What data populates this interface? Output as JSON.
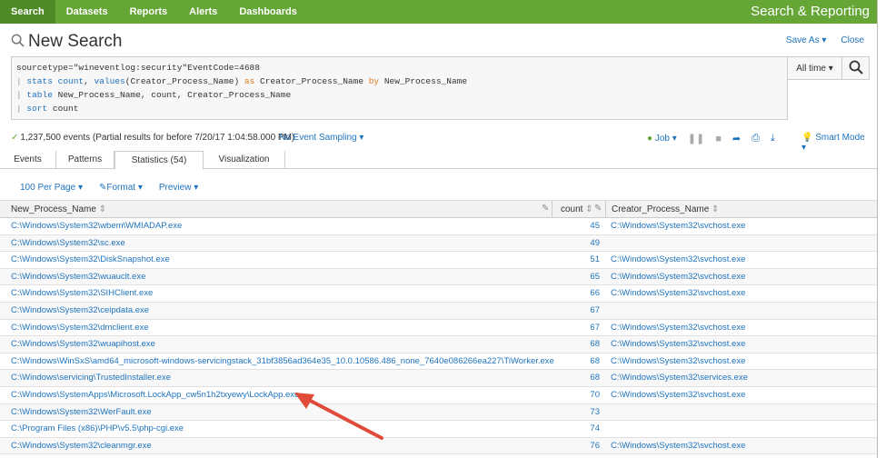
{
  "nav": {
    "items": [
      "Search",
      "Datasets",
      "Reports",
      "Alerts",
      "Dashboards"
    ],
    "app_title": "Search & Reporting"
  },
  "header": {
    "title": "New Search",
    "save_as": "Save As",
    "close": "Close"
  },
  "search": {
    "query_lines": [
      [
        {
          "t": "plain",
          "v": "sourcetype=\"wineventlog:security\"EventCode=4688"
        }
      ],
      [
        {
          "t": "pipe",
          "v": "| "
        },
        {
          "t": "cmd",
          "v": "stats"
        },
        {
          "t": "plain",
          "v": " "
        },
        {
          "t": "cmd",
          "v": "count"
        },
        {
          "t": "plain",
          "v": ", "
        },
        {
          "t": "cmd",
          "v": "values"
        },
        {
          "t": "plain",
          "v": "(Creator_Process_Name) "
        },
        {
          "t": "kw",
          "v": "as"
        },
        {
          "t": "plain",
          "v": " Creator_Process_Name "
        },
        {
          "t": "kw",
          "v": "by"
        },
        {
          "t": "plain",
          "v": " New_Process_Name"
        }
      ],
      [
        {
          "t": "pipe",
          "v": "| "
        },
        {
          "t": "cmd",
          "v": "table"
        },
        {
          "t": "plain",
          "v": " New_Process_Name, count, Creator_Process_Name"
        }
      ],
      [
        {
          "t": "pipe",
          "v": "| "
        },
        {
          "t": "cmd",
          "v": "sort"
        },
        {
          "t": "plain",
          "v": " count"
        }
      ]
    ],
    "time_range": "All time"
  },
  "status": {
    "events": "1,237,500 events (Partial results for before 7/20/17 1:04:58.000 PM)",
    "sampling": "No Event Sampling",
    "job": "Job",
    "mode": "Smart Mode"
  },
  "tabs": [
    "Events",
    "Patterns",
    "Statistics (54)",
    "Visualization"
  ],
  "table_controls": {
    "per_page": "100 Per Page",
    "format": "Format",
    "preview": "Preview"
  },
  "table": {
    "columns": [
      "New_Process_Name",
      "count",
      "Creator_Process_Name"
    ],
    "rows": [
      [
        "C:\\Windows\\System32\\wbem\\WMIADAP.exe",
        "45",
        "C:\\Windows\\System32\\svchost.exe"
      ],
      [
        "C:\\Windows\\System32\\sc.exe",
        "49",
        ""
      ],
      [
        "C:\\Windows\\System32\\DiskSnapshot.exe",
        "51",
        "C:\\Windows\\System32\\svchost.exe"
      ],
      [
        "C:\\Windows\\System32\\wuauclt.exe",
        "65",
        "C:\\Windows\\System32\\svchost.exe"
      ],
      [
        "C:\\Windows\\System32\\SIHClient.exe",
        "66",
        "C:\\Windows\\System32\\svchost.exe"
      ],
      [
        "C:\\Windows\\System32\\ceipdata.exe",
        "67",
        ""
      ],
      [
        "C:\\Windows\\System32\\dmclient.exe",
        "67",
        "C:\\Windows\\System32\\svchost.exe"
      ],
      [
        "C:\\Windows\\System32\\wuapihost.exe",
        "68",
        "C:\\Windows\\System32\\svchost.exe"
      ],
      [
        "C:\\Windows\\WinSxS\\amd64_microsoft-windows-servicingstack_31bf3856ad364e35_10.0.10586.486_none_7640e086266ea227\\TiWorker.exe",
        "68",
        "C:\\Windows\\System32\\svchost.exe"
      ],
      [
        "C:\\Windows\\servicing\\TrustedInstaller.exe",
        "68",
        "C:\\Windows\\System32\\services.exe"
      ],
      [
        "C:\\Windows\\SystemApps\\Microsoft.LockApp_cw5n1h2txyewy\\LockApp.exe",
        "70",
        "C:\\Windows\\System32\\svchost.exe"
      ],
      [
        "C:\\Windows\\System32\\WerFault.exe",
        "73",
        ""
      ],
      [
        "C:\\Program Files (x86)\\PHP\\v5.5\\php-cgi.exe",
        "74",
        ""
      ],
      [
        "C:\\Windows\\System32\\cleanmgr.exe",
        "76",
        "C:\\Windows\\System32\\svchost.exe"
      ]
    ]
  },
  "colors": {
    "nav_green": "#65a637",
    "link_blue": "#1e73be",
    "arrow_red": "#e04b3a"
  }
}
